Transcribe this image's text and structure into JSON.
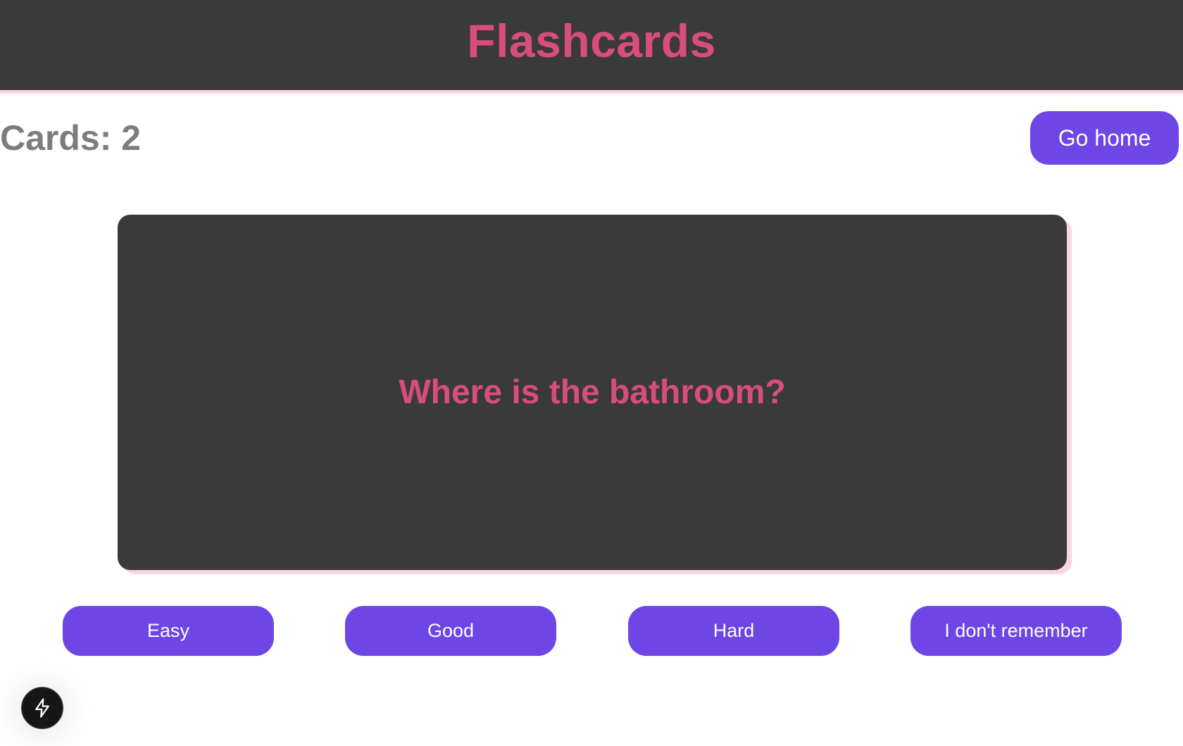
{
  "header": {
    "title": "Flashcards"
  },
  "stats": {
    "cards_label": "Cards: 2"
  },
  "nav": {
    "home_label": "Go home"
  },
  "card": {
    "question": "Where is the bathroom?"
  },
  "answers": [
    {
      "label": "Easy"
    },
    {
      "label": "Good"
    },
    {
      "label": "Hard"
    },
    {
      "label": "I don't remember"
    }
  ],
  "dev_badge": {
    "icon": "lightning-bolt-icon"
  },
  "colors": {
    "header_bg": "#3a3a3a",
    "accent_pink": "#d94d7e",
    "shadow_pink": "#f8d6e2",
    "button_purple": "#6e46e5",
    "muted_text": "#7d7d7d"
  }
}
